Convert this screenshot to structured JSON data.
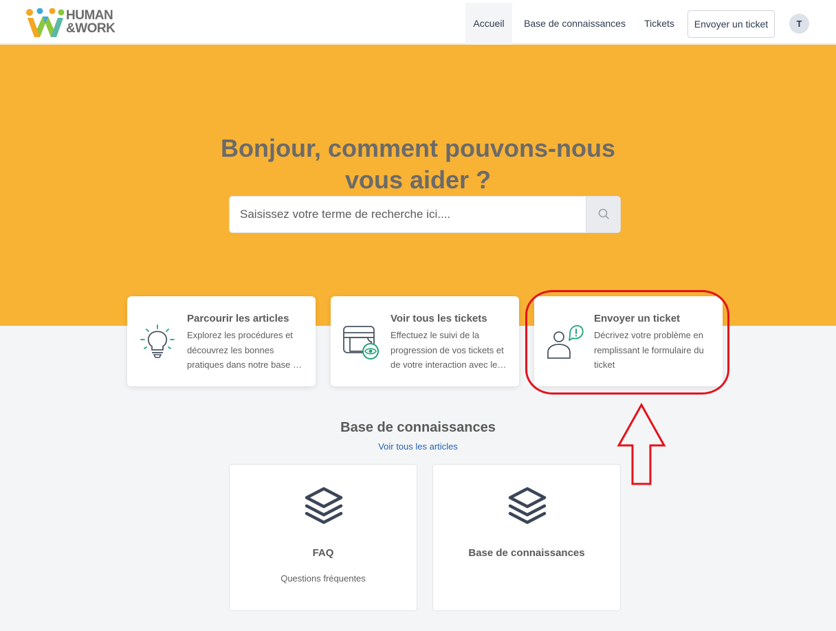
{
  "header": {
    "logo_text_line1": "HUMAN",
    "logo_text_line2": "&WORK",
    "nav": [
      {
        "label": "Accueil",
        "active": true
      },
      {
        "label": "Base de connaissances",
        "active": false
      },
      {
        "label": "Tickets",
        "active": false
      }
    ],
    "cta_label": "Envoyer un ticket",
    "avatar_initial": "T"
  },
  "hero": {
    "title": "Bonjour, comment pouvons-nous vous aider ?",
    "search_placeholder": "Saisissez votre terme de recherche ici....",
    "search_icon": "search-icon"
  },
  "cards": [
    {
      "title": "Parcourir les articles",
      "description": "Explorez les procédures et découvrez les bonnes pratiques dans notre base de connaissances",
      "icon": "lightbulb-icon"
    },
    {
      "title": "Voir tous les tickets",
      "description": "Effectuez le suivi de la progression de vos tickets et de votre interaction avec le support",
      "icon": "tickets-eye-icon"
    },
    {
      "title": "Envoyer un ticket",
      "description": "Décrivez votre problème en remplissant le formulaire du ticket",
      "icon": "user-alert-icon"
    }
  ],
  "knowledge_base": {
    "title": "Base de connaissances",
    "link": "Voir tous les articles",
    "items": [
      {
        "title": "FAQ",
        "description": "Questions fréquentes",
        "icon": "layers-icon"
      },
      {
        "title": "Base de connaissances",
        "description": "",
        "icon": "layers-icon"
      }
    ]
  },
  "colors": {
    "hero_bg": "#f8b234",
    "accent_green": "#1fa37a",
    "annotation_red": "#e3131b",
    "link_blue": "#2863b0"
  }
}
